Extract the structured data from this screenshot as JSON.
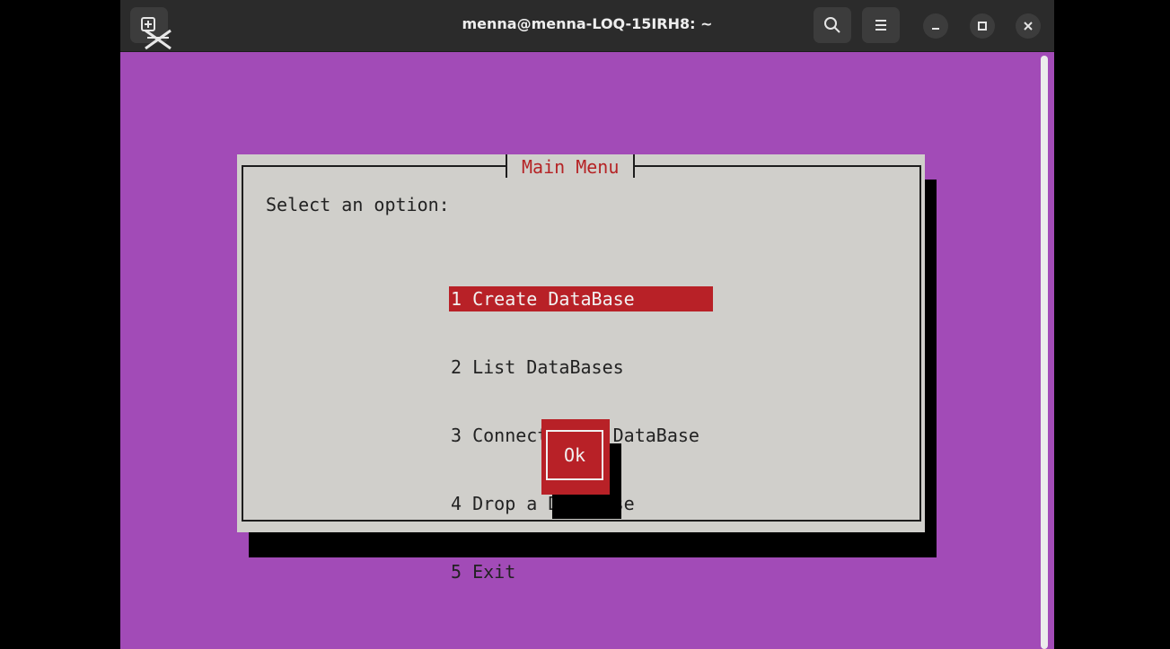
{
  "window": {
    "title": "menna@menna-LOQ-15IRH8: ~",
    "colors": {
      "terminal_bg": "#a24bb7",
      "titlebar_bg": "#2b2b2b"
    },
    "icons": {
      "new_tab": "new-tab-icon",
      "search": "search-icon",
      "menu": "hamburger-menu-icon",
      "minimize": "minimize-icon",
      "maximize": "maximize-icon",
      "close": "close-icon"
    }
  },
  "dialog": {
    "title": "Main Menu",
    "prompt": "Select an option:",
    "items": [
      {
        "label": "1 Create DataBase",
        "selected": true
      },
      {
        "label": "2 List DataBases",
        "selected": false
      },
      {
        "label": "3 Connect To a DataBase",
        "selected": false
      },
      {
        "label": "4 Drop a DataBase",
        "selected": false
      },
      {
        "label": "5 Exit",
        "selected": false
      }
    ],
    "ok_label": "Ok",
    "colors": {
      "accent": "#b82127",
      "background": "#d0cfcb"
    }
  }
}
